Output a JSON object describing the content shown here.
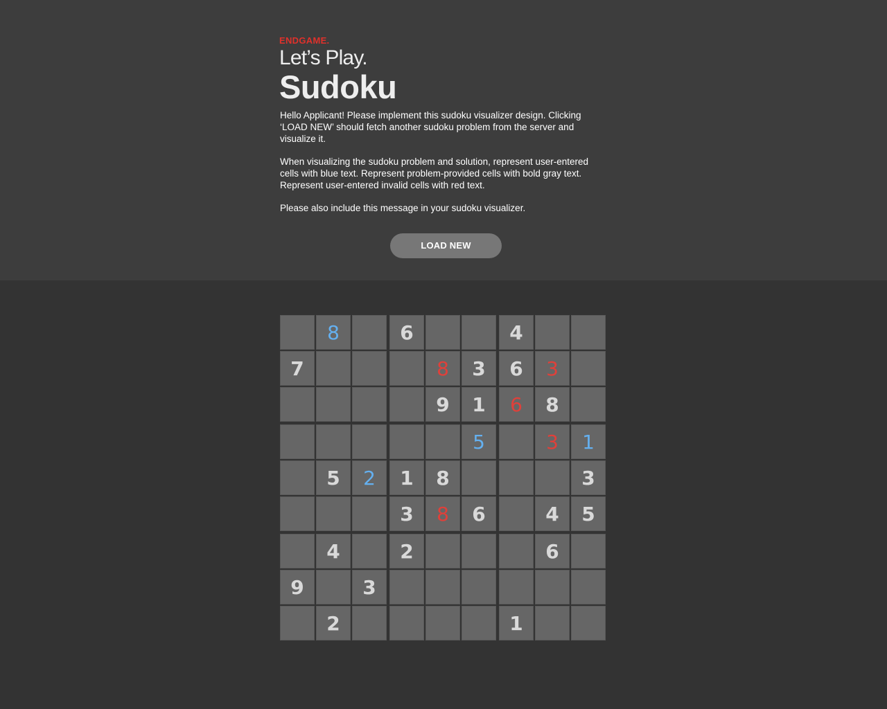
{
  "brand": "ENDGAME.",
  "subtitle": "Let’s Play.",
  "title": "Sudoku",
  "message": {
    "p1": "Hello Applicant! Please implement this sudoku visualizer design. Clicking ‘LOAD NEW’ should fetch another sudoku problem from the server and visualize it.",
    "p2": "When visualizing the sudoku problem and solution, represent user-entered cells with blue text. Represent problem-provided cells with bold gray text. Represent user-entered invalid cells with red text.",
    "p3": "Please also include this message in your sudoku visualizer."
  },
  "load_button": "LOAD NEW",
  "colors": {
    "header_bg": "#3d3d3d",
    "page_bg": "#333333",
    "cell_bg": "#666666",
    "brand": "#e0312b",
    "given": "#d9d9d9",
    "user": "#64b0f0",
    "invalid": "#e0403a",
    "button_bg": "#777777"
  },
  "board": [
    [
      {
        "v": "",
        "t": ""
      },
      {
        "v": "8",
        "t": "user"
      },
      {
        "v": "",
        "t": ""
      },
      {
        "v": "6",
        "t": "given"
      },
      {
        "v": "",
        "t": ""
      },
      {
        "v": "",
        "t": ""
      },
      {
        "v": "4",
        "t": "given"
      },
      {
        "v": "",
        "t": ""
      },
      {
        "v": "",
        "t": ""
      }
    ],
    [
      {
        "v": "7",
        "t": "given"
      },
      {
        "v": "",
        "t": ""
      },
      {
        "v": "",
        "t": ""
      },
      {
        "v": "",
        "t": ""
      },
      {
        "v": "8",
        "t": "invalid"
      },
      {
        "v": "3",
        "t": "given"
      },
      {
        "v": "6",
        "t": "given"
      },
      {
        "v": "3",
        "t": "invalid"
      },
      {
        "v": "",
        "t": ""
      }
    ],
    [
      {
        "v": "",
        "t": ""
      },
      {
        "v": "",
        "t": ""
      },
      {
        "v": "",
        "t": ""
      },
      {
        "v": "",
        "t": ""
      },
      {
        "v": "9",
        "t": "given"
      },
      {
        "v": "1",
        "t": "given"
      },
      {
        "v": "6",
        "t": "invalid"
      },
      {
        "v": "8",
        "t": "given"
      },
      {
        "v": "",
        "t": ""
      }
    ],
    [
      {
        "v": "",
        "t": ""
      },
      {
        "v": "",
        "t": ""
      },
      {
        "v": "",
        "t": ""
      },
      {
        "v": "",
        "t": ""
      },
      {
        "v": "",
        "t": ""
      },
      {
        "v": "5",
        "t": "user"
      },
      {
        "v": "",
        "t": ""
      },
      {
        "v": "3",
        "t": "invalid"
      },
      {
        "v": "1",
        "t": "user"
      }
    ],
    [
      {
        "v": "",
        "t": ""
      },
      {
        "v": "5",
        "t": "given"
      },
      {
        "v": "2",
        "t": "user"
      },
      {
        "v": "1",
        "t": "given"
      },
      {
        "v": "8",
        "t": "given"
      },
      {
        "v": "",
        "t": ""
      },
      {
        "v": "",
        "t": ""
      },
      {
        "v": "",
        "t": ""
      },
      {
        "v": "3",
        "t": "given"
      }
    ],
    [
      {
        "v": "",
        "t": ""
      },
      {
        "v": "",
        "t": ""
      },
      {
        "v": "",
        "t": ""
      },
      {
        "v": "3",
        "t": "given"
      },
      {
        "v": "8",
        "t": "invalid"
      },
      {
        "v": "6",
        "t": "given"
      },
      {
        "v": "",
        "t": ""
      },
      {
        "v": "4",
        "t": "given"
      },
      {
        "v": "5",
        "t": "given"
      }
    ],
    [
      {
        "v": "",
        "t": ""
      },
      {
        "v": "4",
        "t": "given"
      },
      {
        "v": "",
        "t": ""
      },
      {
        "v": "2",
        "t": "given"
      },
      {
        "v": "",
        "t": ""
      },
      {
        "v": "",
        "t": ""
      },
      {
        "v": "",
        "t": ""
      },
      {
        "v": "6",
        "t": "given"
      },
      {
        "v": "",
        "t": ""
      }
    ],
    [
      {
        "v": "9",
        "t": "given"
      },
      {
        "v": "",
        "t": ""
      },
      {
        "v": "3",
        "t": "given"
      },
      {
        "v": "",
        "t": ""
      },
      {
        "v": "",
        "t": ""
      },
      {
        "v": "",
        "t": ""
      },
      {
        "v": "",
        "t": ""
      },
      {
        "v": "",
        "t": ""
      },
      {
        "v": "",
        "t": ""
      }
    ],
    [
      {
        "v": "",
        "t": ""
      },
      {
        "v": "2",
        "t": "given"
      },
      {
        "v": "",
        "t": ""
      },
      {
        "v": "",
        "t": ""
      },
      {
        "v": "",
        "t": ""
      },
      {
        "v": "",
        "t": ""
      },
      {
        "v": "1",
        "t": "given"
      },
      {
        "v": "",
        "t": ""
      },
      {
        "v": "",
        "t": ""
      }
    ]
  ]
}
